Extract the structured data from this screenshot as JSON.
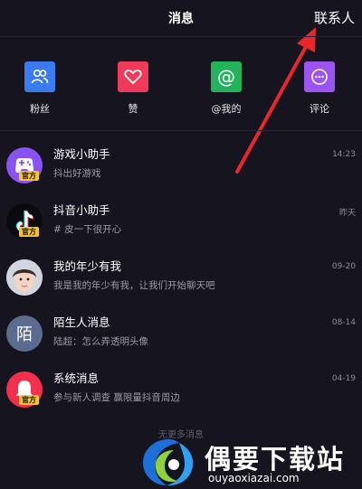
{
  "header": {
    "title": "消息",
    "contacts": "联系人"
  },
  "quick_actions": [
    {
      "label": "粉丝",
      "icon": "fans-icon",
      "color": "#3a7cf0"
    },
    {
      "label": "赞",
      "icon": "heart-icon",
      "color": "#ef3b59"
    },
    {
      "label": "@我的",
      "icon": "at-icon",
      "color": "#23b35b"
    },
    {
      "label": "评论",
      "icon": "comment-icon",
      "color": "#9b54f0"
    }
  ],
  "messages": [
    {
      "name": "游戏小助手",
      "preview": "抖出好游戏",
      "time": "14:23",
      "badge": "官方"
    },
    {
      "name": "抖音小助手",
      "preview": "# 皮一下很开心",
      "time": "昨天",
      "badge": "官方"
    },
    {
      "name": "我的年少有我",
      "preview": "我是我的年少有我，让我们开始聊天吧",
      "time": "09-20"
    },
    {
      "name": "陌生人消息",
      "preview": "陆超：怎么弄透明头像",
      "time": "08-14",
      "avatar_text": "陌"
    },
    {
      "name": "系统消息",
      "preview": "参与新人调查 赢限量抖音周边",
      "time": "04-19",
      "badge": "官方"
    }
  ],
  "footer": {
    "text": "无更多消息"
  },
  "watermark": {
    "title": "偶要下载站",
    "url": "ouyaoxiazai.com"
  },
  "colors": {
    "background": "#15141f",
    "annotation_arrow": "#e8262b",
    "badge": "#f7c42b"
  }
}
